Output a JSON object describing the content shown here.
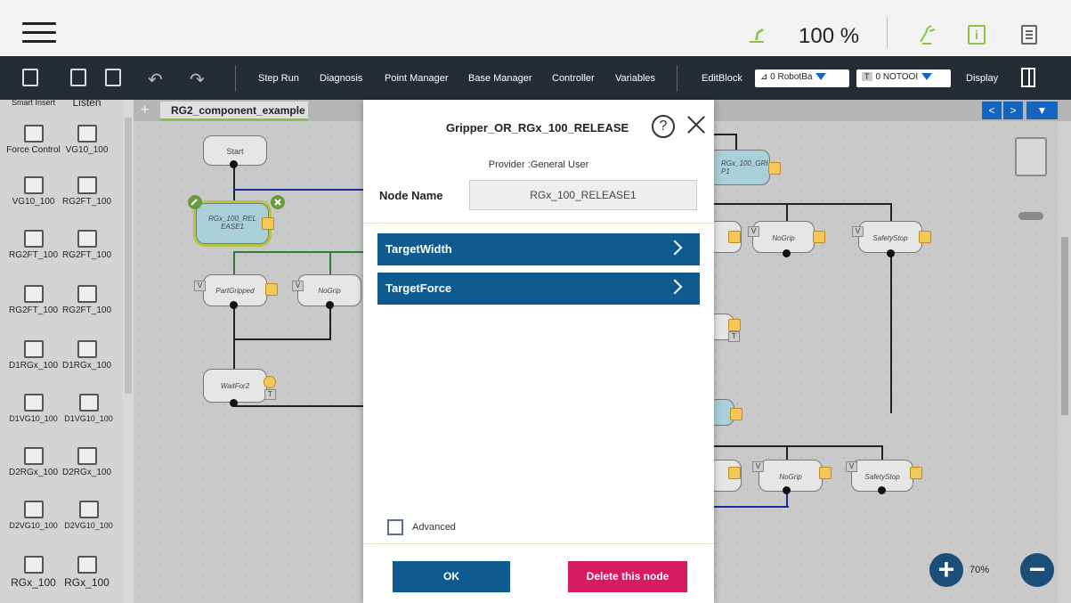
{
  "status": {
    "speed": "100 %"
  },
  "toolbar": {
    "step_run": "Step Run",
    "diagnosis": "Diagnosis",
    "point_manager": "Point Manager",
    "base_manager": "Base Manager",
    "controller": "Controller",
    "variables": "Variables",
    "edit_block": "EditBlock",
    "robot_base": "0 RobotBa",
    "tool_tag": "T",
    "tool": "0 NOTOOI",
    "display": "Display"
  },
  "palette": {
    "header_left": "Smart Insert",
    "header_right": "Listen",
    "items": [
      "Force Control",
      "VG10_100",
      "VG10_100",
      "RG2FT_100",
      "RG2FT_100",
      "RG2FT_100",
      "RG2FT_100",
      "RG2FT_100",
      "D1RGx_100",
      "D1RGx_100",
      "D1VG10_100",
      "D1VG10_100",
      "D2RGx_100",
      "D2RGx_100",
      "D2VG10_100",
      "D2VG10_100",
      "RGx_100",
      "RGx_100"
    ]
  },
  "tabs": {
    "plus": "+",
    "active": "RG2_component_example"
  },
  "canvas": {
    "nodes": {
      "start": "Start",
      "release": "RGx_100_REL EASE1",
      "part_gripped": "PartGripped",
      "no_grip": "NoGrip",
      "wait_for2": "WaitFor2",
      "grip": "RGx_100_GRI P1",
      "no_grip_right": "NoGrip",
      "safety_stop": "SafetyStop",
      "no_grip_right2": "NoGrip",
      "safety_stop2": "SafetyStop"
    },
    "badge_v": "V",
    "badge_t": "T",
    "zoom": "70%",
    "nav_prev": "<",
    "nav_next": ">"
  },
  "dialog": {
    "title": "Gripper_OR_RGx_100_RELEASE",
    "help": "?",
    "provider": "Provider :General User",
    "node_name_label": "Node Name",
    "node_name_value": "RGx_100_RELEASE1",
    "sections": [
      "TargetWidth",
      "TargetForce"
    ],
    "advanced_label": "Advanced",
    "ok_label": "OK",
    "delete_label": "Delete this node"
  }
}
